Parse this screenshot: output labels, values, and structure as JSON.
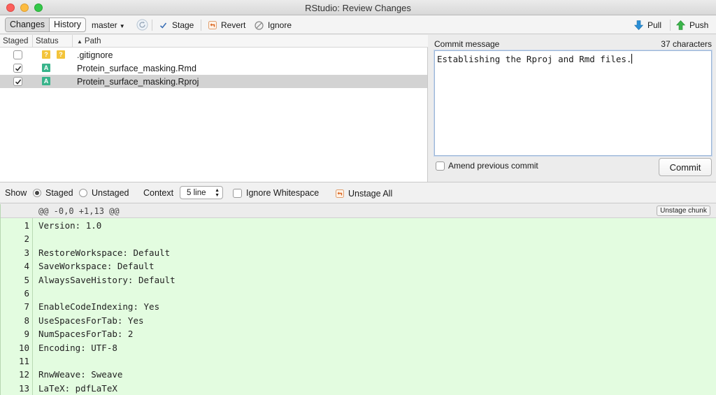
{
  "window": {
    "title": "RStudio: Review Changes"
  },
  "toolbar": {
    "tabs": [
      {
        "label": "Changes"
      },
      {
        "label": "History"
      }
    ],
    "branch": "master",
    "stage": "Stage",
    "revert": "Revert",
    "ignore": "Ignore",
    "pull": "Pull",
    "push": "Push"
  },
  "files": {
    "columns": {
      "staged": "Staged",
      "status": "Status",
      "path": "Path"
    },
    "rows": [
      {
        "staged": false,
        "status": [
          "?",
          "?"
        ],
        "path": ".gitignore",
        "selected": false
      },
      {
        "staged": true,
        "status": [
          "A"
        ],
        "path": "Protein_surface_masking.Rmd",
        "selected": false
      },
      {
        "staged": true,
        "status": [
          "A"
        ],
        "path": "Protein_surface_masking.Rproj",
        "selected": true
      }
    ]
  },
  "commit": {
    "label": "Commit message",
    "char_count": "37 characters",
    "message": "Establishing the Rproj and Rmd files.",
    "amend_label": "Amend previous commit",
    "amend_checked": false,
    "button": "Commit"
  },
  "diff_toolbar": {
    "show_label": "Show",
    "staged_label": "Staged",
    "unstaged_label": "Unstaged",
    "context_label": "Context",
    "context_value": "5 line",
    "ignore_ws_label": "Ignore Whitespace",
    "unstage_all": "Unstage All"
  },
  "diff": {
    "chunk_header": "@@ -0,0 +1,13 @@",
    "unstage_chunk": "Unstage chunk",
    "lines": [
      {
        "num": "1",
        "text": "Version: 1.0"
      },
      {
        "num": "2",
        "text": ""
      },
      {
        "num": "3",
        "text": "RestoreWorkspace: Default"
      },
      {
        "num": "4",
        "text": "SaveWorkspace: Default"
      },
      {
        "num": "5",
        "text": "AlwaysSaveHistory: Default"
      },
      {
        "num": "6",
        "text": ""
      },
      {
        "num": "7",
        "text": "EnableCodeIndexing: Yes"
      },
      {
        "num": "8",
        "text": "UseSpacesForTab: Yes"
      },
      {
        "num": "9",
        "text": "NumSpacesForTab: 2"
      },
      {
        "num": "10",
        "text": "Encoding: UTF-8"
      },
      {
        "num": "11",
        "text": ""
      },
      {
        "num": "12",
        "text": "RnwWeave: Sweave"
      },
      {
        "num": "13",
        "text": "LaTeX: pdfLaTeX"
      }
    ]
  },
  "colors": {
    "added_bg": "#e3fce0",
    "badge_added": "#38b48b",
    "badge_untracked": "#f3c43a"
  }
}
